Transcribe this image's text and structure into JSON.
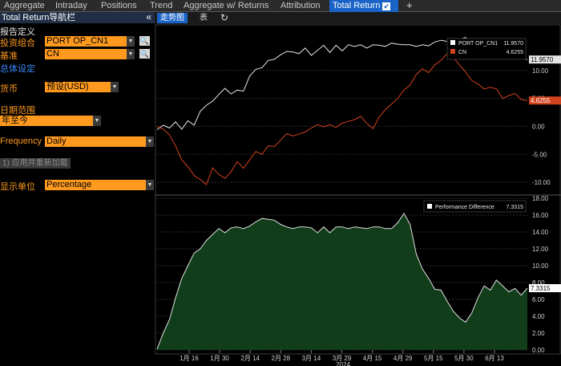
{
  "tabs": [
    "Aggregate",
    "Intraday",
    "Positions",
    "Trend",
    "Aggregate w/ Returns",
    "Attribution",
    "Total Return"
  ],
  "active_tab_check": "✔",
  "add_tab": "+",
  "nav": {
    "title": "Total Return导航栏",
    "collapse": "«",
    "report_def": "报告定义",
    "portfolio_label": "投资组合",
    "portfolio_value": "PORT OP_CN1",
    "benchmark_label": "基准",
    "benchmark_value": "CN",
    "overview": "总体设定",
    "currency_label": "货币",
    "currency_value": "预设(USD)",
    "date_range_label": "日期范围",
    "date_range_value": "年至今",
    "frequency_label": "Frequency",
    "frequency_value": "Daily",
    "apply_button": "应用并重新加载",
    "display_unit_label": "显示单位",
    "display_unit_value": "Percentage",
    "search_glyph": "🔍",
    "dropdown_glyph": "▼"
  },
  "chart_tabs": [
    "走势图",
    "表"
  ],
  "refresh_glyph": "↻",
  "colors": {
    "portfolio": "#e6e6e6",
    "benchmark": "#d2421d",
    "area_fill": "#113d1a",
    "area_line": "#e0e0e0",
    "grid": "#2e2e2e",
    "orange": "#ff9a1f",
    "tab_active": "#1a63c7"
  },
  "chart_data": [
    {
      "type": "line",
      "series": [
        {
          "name": "PORT OP_CN1",
          "last": "11.9570",
          "values": [
            -0.6,
            0.2,
            -0.3,
            0.8,
            -0.5,
            1.0,
            0.2,
            2.7,
            3.8,
            4.5,
            5.7,
            6.8,
            5.8,
            6.5,
            6.3,
            9.0,
            10.2,
            10.5,
            11.8,
            12.0,
            12.8,
            13.4,
            13.3,
            13.0,
            14.0,
            12.7,
            13.6,
            14.5,
            13.2,
            14.5,
            13.5,
            14.6,
            14.3,
            14.6,
            14.0,
            14.6,
            14.5,
            14.3,
            14.9,
            14.7,
            14.6,
            14.6,
            14.3,
            14.6,
            14.4,
            15.1,
            15.4,
            15.2,
            15.7,
            15.6,
            15.9,
            14.8,
            15.3,
            14.6,
            14.2,
            13.8,
            13.5,
            12.9,
            12.6,
            12.2,
            11.957
          ]
        },
        {
          "name": "CN",
          "last": "4.6255",
          "values": [
            0.0,
            -0.5,
            -1.5,
            -3.5,
            -6.0,
            -7.2,
            -8.8,
            -9.5,
            -10.4,
            -7.4,
            -8.6,
            -9.3,
            -8.1,
            -6.3,
            -7.5,
            -6.0,
            -4.5,
            -5.0,
            -3.5,
            -3.6,
            -2.5,
            -1.3,
            -1.7,
            -1.4,
            -1.0,
            -0.3,
            0.3,
            -0.1,
            0.3,
            -0.2,
            0.6,
            0.9,
            1.2,
            1.8,
            0.5,
            -0.4,
            1.7,
            3.0,
            4.0,
            5.0,
            6.5,
            7.4,
            9.3,
            10.3,
            9.6,
            11.0,
            11.8,
            13.0,
            12.3,
            11.0,
            9.7,
            8.2,
            7.6,
            6.7,
            7.0,
            6.7,
            5.0,
            5.5,
            5.9,
            4.8,
            4.6255
          ]
        }
      ],
      "ylim": [
        -12,
        16
      ],
      "y_ticks": [
        "10.00",
        "5.00",
        "0.00",
        "-5.00",
        "-10.00"
      ],
      "legend": "top-right",
      "grid": true
    },
    {
      "type": "area",
      "series": [
        {
          "name": "Performance Difference",
          "last": "7.3315",
          "values": [
            0.1,
            2.0,
            3.6,
            6.2,
            8.5,
            10.0,
            11.5,
            12.0,
            13.0,
            13.7,
            14.4,
            13.9,
            14.5,
            14.6,
            14.4,
            14.7,
            15.2,
            15.6,
            15.5,
            15.4,
            14.9,
            14.6,
            14.4,
            14.6,
            14.6,
            14.5,
            13.9,
            14.6,
            13.9,
            14.6,
            14.6,
            14.4,
            14.6,
            14.5,
            14.4,
            14.6,
            14.6,
            14.4,
            14.4,
            15.1,
            16.2,
            14.9,
            11.4,
            9.6,
            8.5,
            7.2,
            7.1,
            5.8,
            4.6,
            3.8,
            3.3,
            4.4,
            6.2,
            7.6,
            7.1,
            8.3,
            7.6,
            6.9,
            7.3,
            6.5,
            7.3315
          ]
        }
      ],
      "ylim": [
        0,
        18
      ],
      "y_ticks": [
        "18.00",
        "16.00",
        "14.00",
        "12.00",
        "10.00",
        "8.00",
        "6.00",
        "4.00",
        "2.00",
        "0.00"
      ],
      "x_ticks": [
        "1月 16",
        "1月 30",
        "2月 14",
        "2月 28",
        "3月 14",
        "3月 29",
        "4月 15",
        "4月 29",
        "5月 15",
        "5月 30",
        "6月 13"
      ],
      "x_year": "2024",
      "legend": "top-right",
      "grid": true
    }
  ]
}
